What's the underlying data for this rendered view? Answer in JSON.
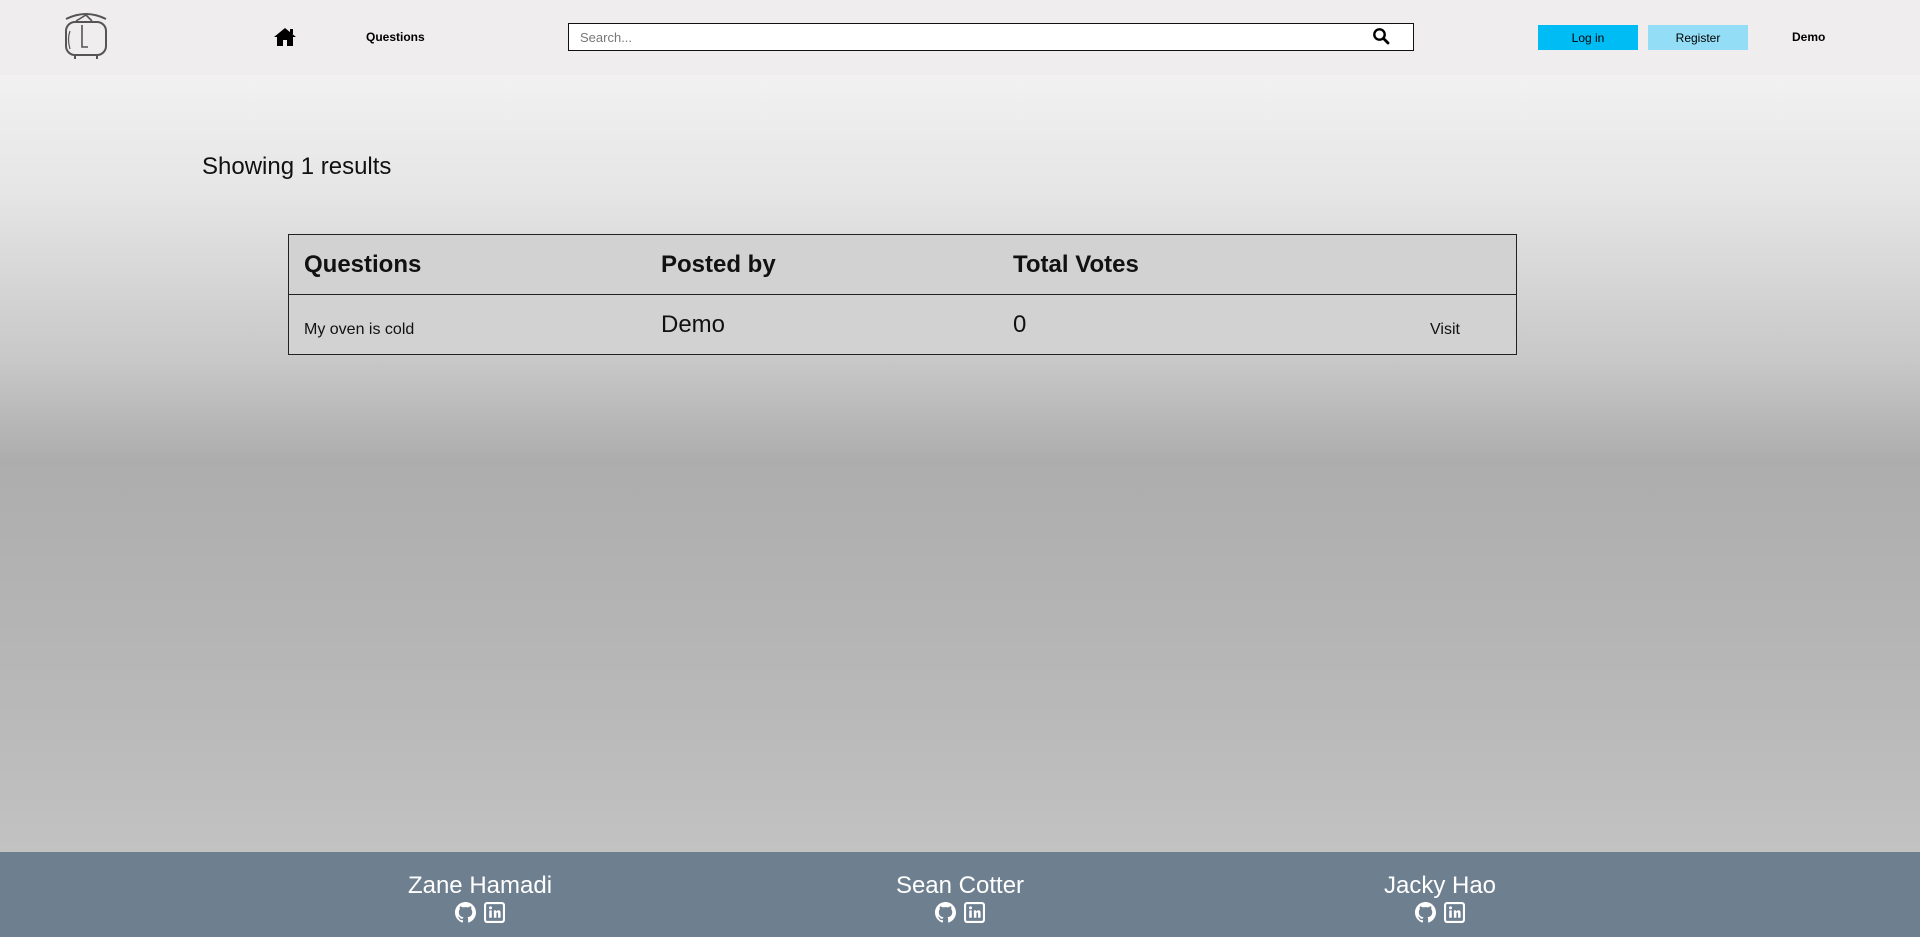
{
  "nav": {
    "questions_label": "Questions",
    "search_placeholder": "Search...",
    "login_label": "Log in",
    "register_label": "Register",
    "user_label": "Demo",
    "icons": {
      "logo": "pot-logo-icon",
      "home": "home-icon",
      "search": "search-icon"
    }
  },
  "main": {
    "results_heading": "Showing 1 results",
    "table": {
      "headers": [
        "Questions",
        "Posted by",
        "Total Votes"
      ],
      "rows": [
        {
          "question": "My oven is cold",
          "posted_by": "Demo",
          "votes": "0",
          "action": "Visit"
        }
      ]
    }
  },
  "footer": {
    "developers": [
      {
        "name": "Zane Hamadi",
        "icons": [
          "github-icon",
          "linkedin-icon"
        ]
      },
      {
        "name": "Sean Cotter",
        "icons": [
          "github-icon",
          "linkedin-icon"
        ]
      },
      {
        "name": "Jacky Hao",
        "icons": [
          "github-icon",
          "linkedin-icon"
        ]
      }
    ]
  },
  "colors": {
    "login_button": "#00bcf5",
    "register_button": "#94ddf6",
    "footer_bg": "#6e7f90",
    "navbar_bg": "#efedee"
  }
}
